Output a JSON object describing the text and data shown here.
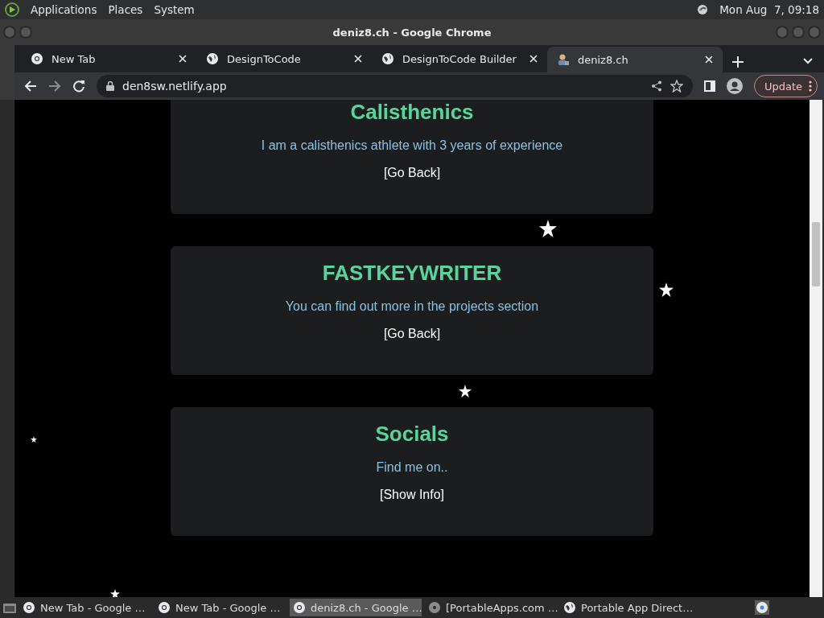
{
  "panel": {
    "menus": [
      "Applications",
      "Places",
      "System"
    ],
    "clock": "Mon Aug  7, 09:18"
  },
  "window": {
    "title": "deniz8.ch - Google Chrome"
  },
  "tabs": [
    {
      "label": "New Tab",
      "kind": "chrome",
      "selected": false
    },
    {
      "label": "DesignToCode",
      "kind": "globe",
      "selected": false
    },
    {
      "label": "DesignToCode Builder",
      "kind": "globe",
      "selected": false
    },
    {
      "label": "deniz8.ch",
      "kind": "avatar",
      "selected": true
    }
  ],
  "address_bar": {
    "url": "den8sw.netlify.app",
    "update_button": "Update"
  },
  "cards": [
    {
      "title": "Calisthenics",
      "text": "I am a calisthenics athlete with 3 years of experience",
      "action": "[Go Back]"
    },
    {
      "title": "FASTKEYWRITER",
      "text": "You can find out more in the projects section",
      "action": "[Go Back]"
    },
    {
      "title": "Socials",
      "text": "Find me on..",
      "action": "[Show Info]"
    }
  ],
  "taskbar": [
    {
      "label": "New Tab - Google …",
      "kind": "chrome",
      "selected": false
    },
    {
      "label": "New Tab - Google …",
      "kind": "chrome",
      "selected": false
    },
    {
      "label": "deniz8.ch - Google …",
      "kind": "chrome",
      "selected": true
    },
    {
      "label": "[PortableApps.com …",
      "kind": "disc",
      "selected": false
    },
    {
      "label": "Portable App Direct…",
      "kind": "globe",
      "selected": false
    }
  ]
}
